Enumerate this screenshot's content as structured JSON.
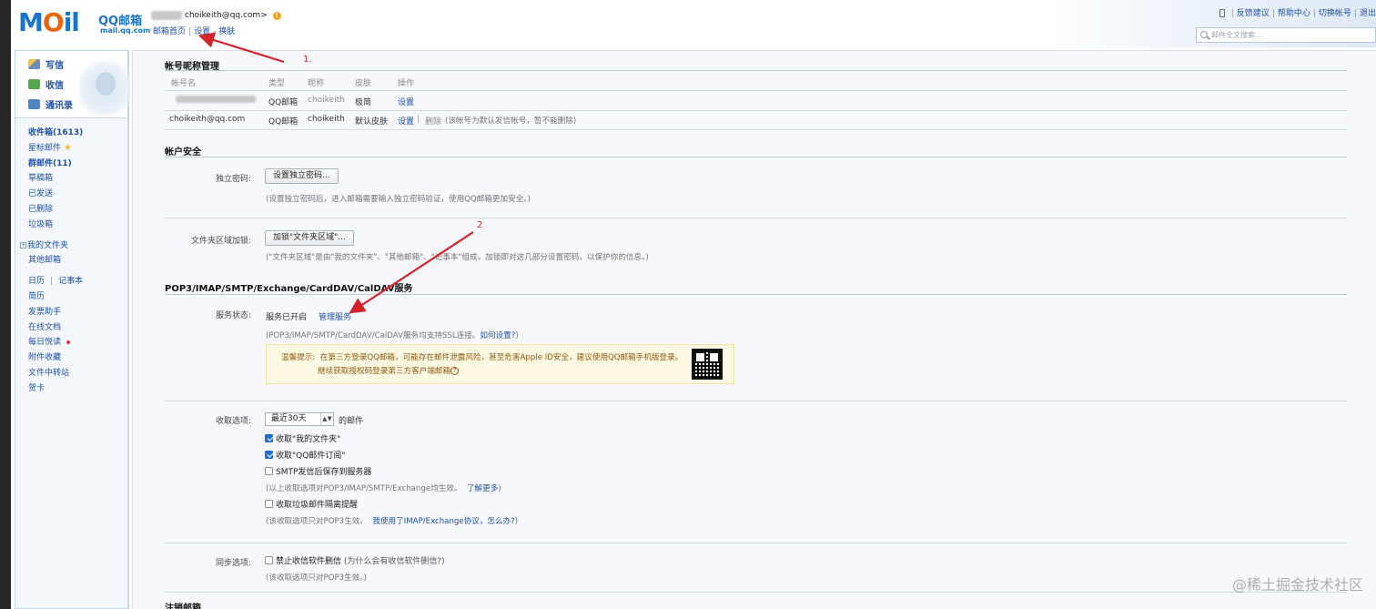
{
  "header": {
    "logo_main": "MOil",
    "logo_cn": "QQ邮箱",
    "logo_url": "mail.qq.com",
    "user_email": "choikeith@qq.com>",
    "links": [
      "邮箱首页",
      "设置",
      "换肤"
    ],
    "link_dash": "-",
    "top_right_links": [
      "反馈建议",
      "帮助中心",
      "切换帐号",
      "退出"
    ],
    "search_placeholder": "邮件全文搜索..."
  },
  "sidebar": {
    "top_items": [
      "写信",
      "收信",
      "通讯录"
    ],
    "folders": {
      "inbox": "收件箱(1613)",
      "starred": "星标邮件",
      "group": "群邮件(11)",
      "drafts": "草稿箱",
      "sent": "已发送",
      "deleted": "已删除",
      "spam": "垃圾箱",
      "my_folders": "我的文件夹",
      "other": "其他邮箱",
      "calendar": "日历",
      "notes": "记事本",
      "resume": "简历",
      "invoice": "发票助手",
      "docs": "在线文档",
      "daily": "每日悦读",
      "attachments": "附件收藏",
      "transfer": "文件中转站",
      "cards": "贺卡"
    }
  },
  "account": {
    "title": "帐号昵称管理",
    "headers": [
      "帐号名",
      "类型",
      "昵称",
      "皮肤",
      "操作"
    ],
    "row1": {
      "type": "QQ邮箱",
      "nickname": "choikeith",
      "skin": "极简",
      "action": "设置"
    },
    "row2": {
      "name": "choikeith@qq.com",
      "type": "QQ邮箱",
      "nickname": "choikeith",
      "skin": "默认皮肤",
      "action": "设置",
      "delete": "删除",
      "note": "(该帐号为默认发信帐号，暂不能删除)"
    }
  },
  "security": {
    "title": "帐户安全",
    "pwd_label": "独立密码:",
    "pwd_button": "设置独立密码...",
    "pwd_note": "(设置独立密码后，进入邮箱需要输入独立密码验证，使用QQ邮箱更加安全。)",
    "lock_label": "文件夹区域加锁:",
    "lock_button": "加锁\"文件夹区域\"...",
    "lock_note": "(\"文件夹区域\"是由\"我的文件夹\"、\"其他邮箱\"、\"记事本\"组成。加锁即对这几部分设置密码，以保护你的信息。)"
  },
  "pop3": {
    "title": "POP3/IMAP/SMTP/Exchange/CardDAV/CalDAV服务",
    "status_label": "服务状态:",
    "status_value": "服务已开启",
    "manage_link": "管理服务",
    "ssl_note": "(POP3/IMAP/SMTP/CardDAV/CalDAV服务均支持SSL连接。",
    "ssl_link": "如何设置?",
    "ssl_close": ")",
    "tip_head": "温馨提示:",
    "tip_line1": "在第三方登录QQ邮箱，可能存在邮件泄露风险，甚至危害Apple ID安全，建议使用QQ邮箱手机版登录。",
    "tip_line2": "继续获取授权码登录第三方客户端邮箱",
    "tip_help": "?",
    "receive_label": "收取选项:",
    "receive_select": "最近30天",
    "receive_suffix": "的邮件",
    "opt_myfolders": "收取\"我的文件夹\"",
    "opt_subscribe": "收取\"QQ邮件订阅\"",
    "opt_smtp_save": "SMTP发信后保存到服务器",
    "opt_note": "(以上收取选项对POP3/IMAP/SMTP/Exchange均生效。",
    "opt_learn": "了解更多",
    "opt_close": ")",
    "opt_spam": "收取垃圾邮件隔离提醒",
    "opt_note2": "(该收取选项只对POP3生效。",
    "opt_note2_link": "我使用了IMAP/Exchange协议，怎么办?",
    "opt_note2_close": ")",
    "sync_label": "同步选项:",
    "sync_option": "禁止收信软件删信",
    "sync_link": "(为什么会有收信软件删信?)",
    "sync_note": "(该收取选项只对POP3生效。)"
  },
  "cancel": {
    "title": "注销邮箱"
  },
  "annotations": {
    "one": "1.",
    "two": "2"
  },
  "watermark": "@稀土掘金技术社区"
}
